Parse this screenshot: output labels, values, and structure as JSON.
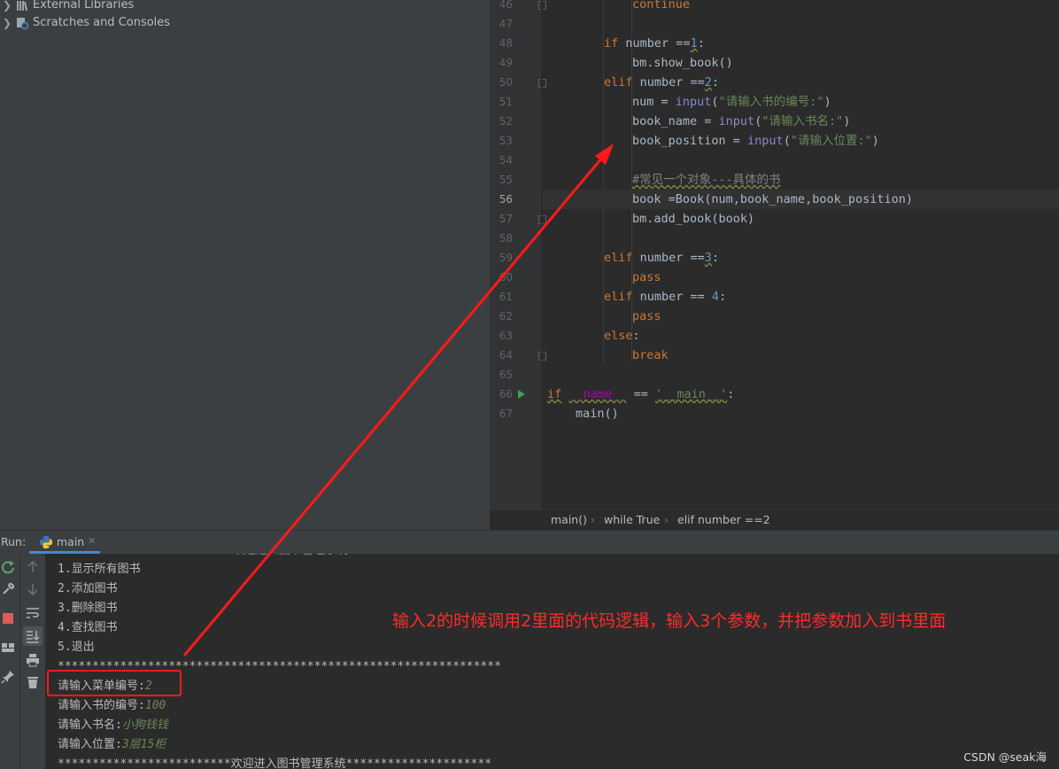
{
  "project_tree": [
    {
      "label": "External Libraries",
      "icon": "libraries-icon"
    },
    {
      "label": "Scratches and Consoles",
      "icon": "scratches-icon"
    }
  ],
  "editor": {
    "lines": [
      {
        "n": "46"
      },
      {
        "n": "47"
      },
      {
        "n": "48"
      },
      {
        "n": "49"
      },
      {
        "n": "50"
      },
      {
        "n": "51"
      },
      {
        "n": "52"
      },
      {
        "n": "53"
      },
      {
        "n": "54"
      },
      {
        "n": "55"
      },
      {
        "n": "56"
      },
      {
        "n": "57"
      },
      {
        "n": "58"
      },
      {
        "n": "59"
      },
      {
        "n": "60"
      },
      {
        "n": "61"
      },
      {
        "n": "62"
      },
      {
        "n": "63"
      },
      {
        "n": "64"
      },
      {
        "n": "65"
      },
      {
        "n": "66"
      },
      {
        "n": "67"
      }
    ],
    "code": {
      "l46": "continue",
      "l48_kw": "if",
      "l48_a": " number ==",
      "l48_num": "1",
      "l48_b": ":",
      "l49": "bm.show_book()",
      "l50_kw": "elif",
      "l50_a": " number ==",
      "l50_num": "2",
      "l50_b": ":",
      "l51_a": "num = ",
      "l51_fn": "input",
      "l51_b": "(",
      "l51_str": "\"请输入书的编号:\"",
      "l51_c": ")",
      "l52_a": "book_name = ",
      "l52_fn": "input",
      "l52_b": "(",
      "l52_str": "\"请输入书名:\"",
      "l52_c": ")",
      "l53_a": "book_position = ",
      "l53_fn": "input",
      "l53_b": "(",
      "l53_str": "\"请输入位置:\"",
      "l53_c": ")",
      "l55": "#常见一个对象---具体的书",
      "l56": "book =Book(num,book_name,book_position)",
      "l57": "bm.add_book(book)",
      "l59_kw": "elif",
      "l59_a": " number ==",
      "l59_num": "3",
      "l59_b": ":",
      "l60": "pass",
      "l61_kw": "elif",
      "l61_a": " number == ",
      "l61_num": "4",
      "l61_b": ":",
      "l62": "pass",
      "l63_kw": "else",
      "l63_b": ":",
      "l64": "break",
      "l66_kw": "if",
      "l66_a": " ",
      "l66_d": "__name__",
      "l66_b": " == ",
      "l66_str": "'__main__'",
      "l66_c": ":",
      "l67": "main()"
    }
  },
  "breadcrumb": [
    "main()",
    "while True",
    "elif number ==2"
  ],
  "run": {
    "label": "Run:",
    "tab": "main"
  },
  "console": {
    "partial_top": "欢迎进入图书管理系统",
    "menu": [
      "1.显示所有图书",
      "2.添加图书",
      "3.删除图书",
      "4.查找图书",
      "5.退出"
    ],
    "stars": "****************************************************************",
    "prompts": [
      {
        "label": "请输入菜单编号:",
        "value": "2"
      },
      {
        "label": "请输入书的编号:",
        "value": "100"
      },
      {
        "label": "请输入书名:",
        "value": "小狗钱钱"
      },
      {
        "label": "请输入位置:",
        "value": "3层15柜"
      }
    ],
    "banner": "*************************欢迎进入图书管理系统*********************"
  },
  "annotation": "输入2的时候调用2里面的代码逻辑，输入3个参数，并把参数加入到书里面",
  "watermark": "CSDN @seak海",
  "colors": {
    "annotation": "#ff2a2a",
    "keyword": "#cc7832",
    "string": "#6a8759",
    "number": "#6897bb",
    "builtin": "#8888c6"
  }
}
